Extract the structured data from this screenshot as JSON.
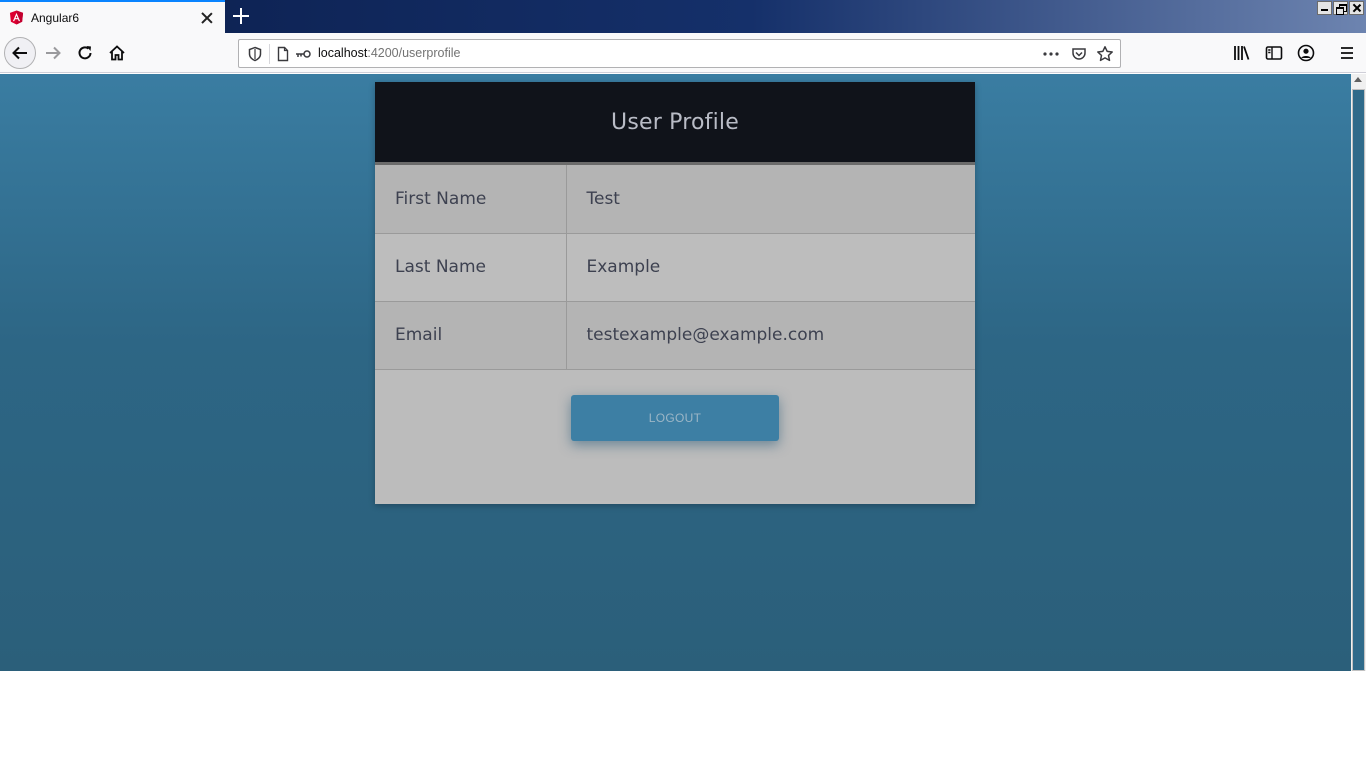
{
  "browser": {
    "tab": {
      "title": "Angular6",
      "favicon": "angular-icon"
    },
    "url": {
      "host": "localhost",
      "rest": ":4200/userprofile"
    }
  },
  "page": {
    "title": "User Profile",
    "fields": [
      {
        "label": "First Name",
        "value": "Test"
      },
      {
        "label": "Last Name",
        "value": "Example"
      },
      {
        "label": "Email",
        "value": "testexample@example.com"
      }
    ],
    "logout_label": "LOGOUT"
  },
  "colors": {
    "background": "#2d6685",
    "header": "#10131a",
    "card": "#bdbdbd",
    "button": "#3d7fa4"
  }
}
